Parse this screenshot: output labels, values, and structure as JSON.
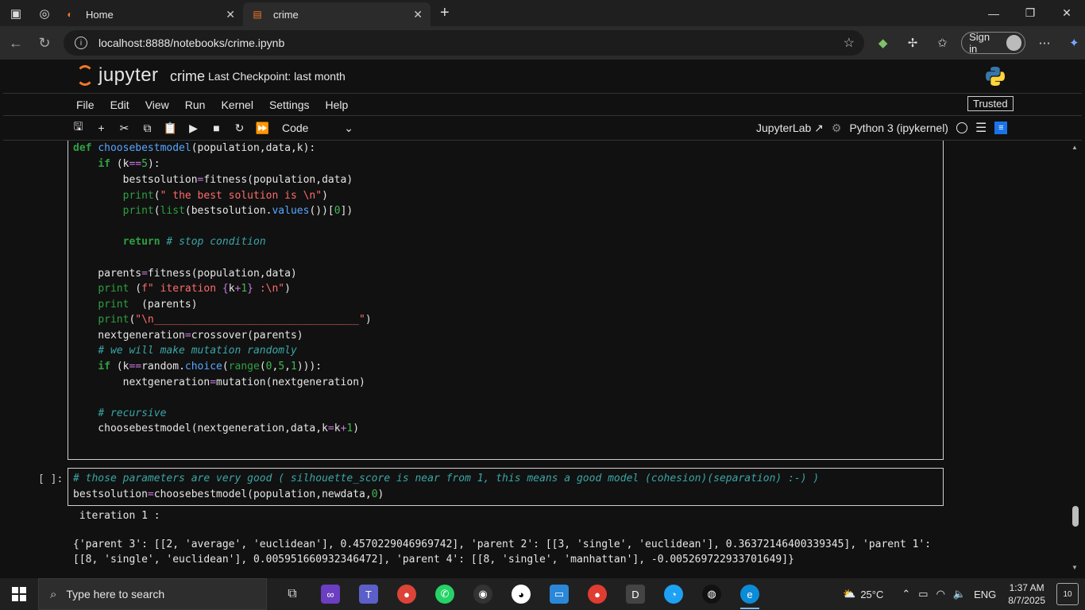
{
  "browser": {
    "tabs": [
      {
        "title": "Home"
      },
      {
        "title": "crime"
      }
    ],
    "url": "localhost:8888/notebooks/crime.ipynb",
    "signin_label": "Sign in"
  },
  "jupyter": {
    "logo_text": "jupyter",
    "notebook_name": "crime",
    "checkpoint": "Last Checkpoint: last month",
    "menu": [
      "File",
      "Edit",
      "View",
      "Run",
      "Kernel",
      "Settings",
      "Help"
    ],
    "trusted_label": "Trusted",
    "cell_type": "Code",
    "jupyterlab_link": "JupyterLab",
    "kernel": "Python 3 (ipykernel)"
  },
  "cells": {
    "cell2_prompt": "[ ]:",
    "output_title": " iteration 1 :",
    "output_line1": "{'parent 3': [[2, 'average', 'euclidean'], 0.4570229046969742], 'parent 2': [[3, 'single', 'euclidean'], 0.36372146400339345], 'parent 1':",
    "output_line2": "[[8, 'single', 'euclidean'], 0.005951660932346472], 'parent 4': [[8, 'single', 'manhattan'], -0.005269722933701649]}"
  },
  "taskbar": {
    "search_placeholder": "Type here to search",
    "temperature": "25°C",
    "language": "ENG",
    "time": "1:37 AM",
    "date": "8/7/2025",
    "notification_count": "10"
  }
}
